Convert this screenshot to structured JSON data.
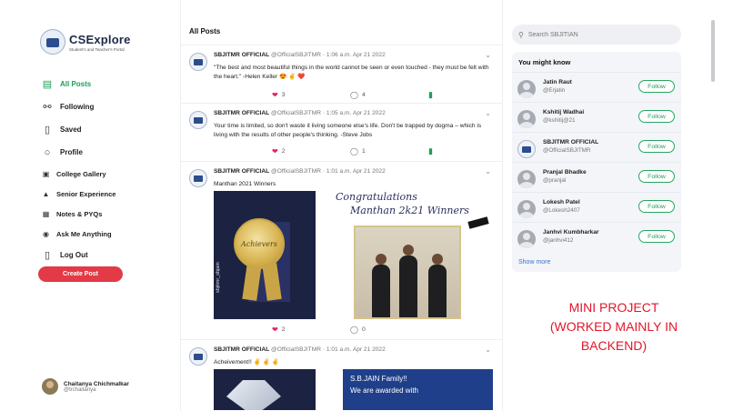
{
  "brand": {
    "name": "CSExplore",
    "tagline": "Student's and Teacher's Portal"
  },
  "nav": {
    "items": [
      {
        "label": "All Posts",
        "icon": "list-icon"
      },
      {
        "label": "Following",
        "icon": "people-icon"
      },
      {
        "label": "Saved",
        "icon": "bookmark-icon"
      },
      {
        "label": "Profile",
        "icon": "person-icon"
      },
      {
        "label": "College Gallery",
        "icon": "gallery-icon"
      },
      {
        "label": "Senior Experience",
        "icon": "graduation-cap-icon"
      },
      {
        "label": "Notes & PYQs",
        "icon": "book-icon"
      },
      {
        "label": "Ask Me Anything",
        "icon": "chat-icon"
      },
      {
        "label": "Log Out",
        "icon": "door-icon"
      }
    ],
    "create_post": "Create Post"
  },
  "current_user": {
    "name": "Chaitanya Chichmalkar",
    "handle": "@trchaitanya"
  },
  "feed": {
    "title": "All Posts",
    "posts": [
      {
        "name": "SBJITMR OFFICIAL",
        "handle": "@OfficialSBJITMR",
        "separator": "·",
        "time": "1:06 a.m. Apr 21 2022",
        "text": "\"The best and most beautiful things in the world cannot be seen or even touched - they must be felt with the heart.\" -Helen Keller 😍 ✌️ ❤️",
        "likes": "3",
        "comments": "4"
      },
      {
        "name": "SBJITMR OFFICIAL",
        "handle": "@OfficialSBJITMR",
        "separator": "·",
        "time": "1:05 a.m. Apr 21 2022",
        "text": "Your time is limited, so don't waste it living someone else's life. Don't be trapped by dogma – which is living with the results of other people's thinking. -Steve Jobs",
        "likes": "2",
        "comments": "1"
      },
      {
        "name": "SBJITMR OFFICIAL",
        "handle": "@OfficialSBJITMR",
        "separator": "·",
        "time": "1:01 a.m. Apr 21 2022",
        "text": "Manthan 2021 Winners",
        "likes": "2",
        "comments": "0",
        "image": {
          "seal_text": "Achievers",
          "side_text": "sbjitmr_sbjain",
          "headline_1": "Congratulations",
          "headline_2": "Manthan 2k21 Winners"
        }
      },
      {
        "name": "SBJITMR OFFICIAL",
        "handle": "@OfficialSBJITMR",
        "separator": "·",
        "time": "1:01 a.m. Apr 21 2022",
        "text": "Acheivement!! ✌️ ✌️ ✌️",
        "image": {
          "line_1": "S.B.JAIN Family!!",
          "line_2": "We are awarded with"
        }
      }
    ]
  },
  "search": {
    "placeholder": "Search SBJITIAN"
  },
  "suggestions": {
    "title": "You might know",
    "follow_label": "Follow",
    "show_more": "Show more",
    "people": [
      {
        "name": "Jatin Raut",
        "handle": "@Erjatin"
      },
      {
        "name": "Kshitij Wadhai",
        "handle": "@kshitij@21"
      },
      {
        "name": "SBJITMR OFFICIAL",
        "handle": "@OfficialSBJITMR"
      },
      {
        "name": "Pranjal Bhadke",
        "handle": "@pranjal"
      },
      {
        "name": "Lokesh Patel",
        "handle": "@Lokesh2407"
      },
      {
        "name": "Janhvi Kumbharkar",
        "handle": "@janhvi412"
      }
    ]
  },
  "annotation": {
    "line_1": "MINI PROJECT",
    "line_2": "(WORKED  MAINLY IN",
    "line_3": "BACKEND)"
  },
  "colors": {
    "accent": "#1e9e57",
    "create": "#e23a46",
    "like": "#e0246e",
    "note": "#e2162a",
    "link": "#3b76c6"
  }
}
